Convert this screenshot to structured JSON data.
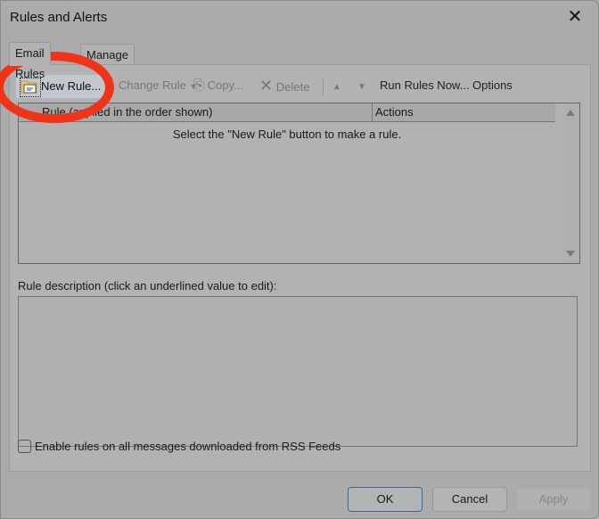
{
  "window": {
    "title": "Rules and Alerts",
    "close_icon": "close-icon"
  },
  "tabs": [
    {
      "label": "Email Rules",
      "active": true
    },
    {
      "label": "Manage Alerts",
      "active": false
    }
  ],
  "toolbar": {
    "new_rule": "New Rule...",
    "change_rule": "Change Rule",
    "copy": "Copy...",
    "delete": "Delete",
    "move_up_icon": "arrow-up-icon",
    "move_down_icon": "arrow-down-icon",
    "run_rules_now": "Run Rules Now...",
    "options": "Options"
  },
  "rules_list": {
    "columns": [
      "Rule (applied in the order shown)",
      "Actions"
    ],
    "empty_message": "Select the \"New Rule\" button to make a rule.",
    "rows": []
  },
  "description": {
    "label": "Rule description (click an underlined value to edit):",
    "text": ""
  },
  "rss_option": {
    "label": "Enable rules on all messages downloaded from RSS Feeds",
    "checked": false
  },
  "buttons": {
    "ok": "OK",
    "cancel": "Cancel",
    "apply": "Apply"
  },
  "annotation": {
    "highlight_color": "#f0341a",
    "highlighted_element": "new-rule-button"
  }
}
